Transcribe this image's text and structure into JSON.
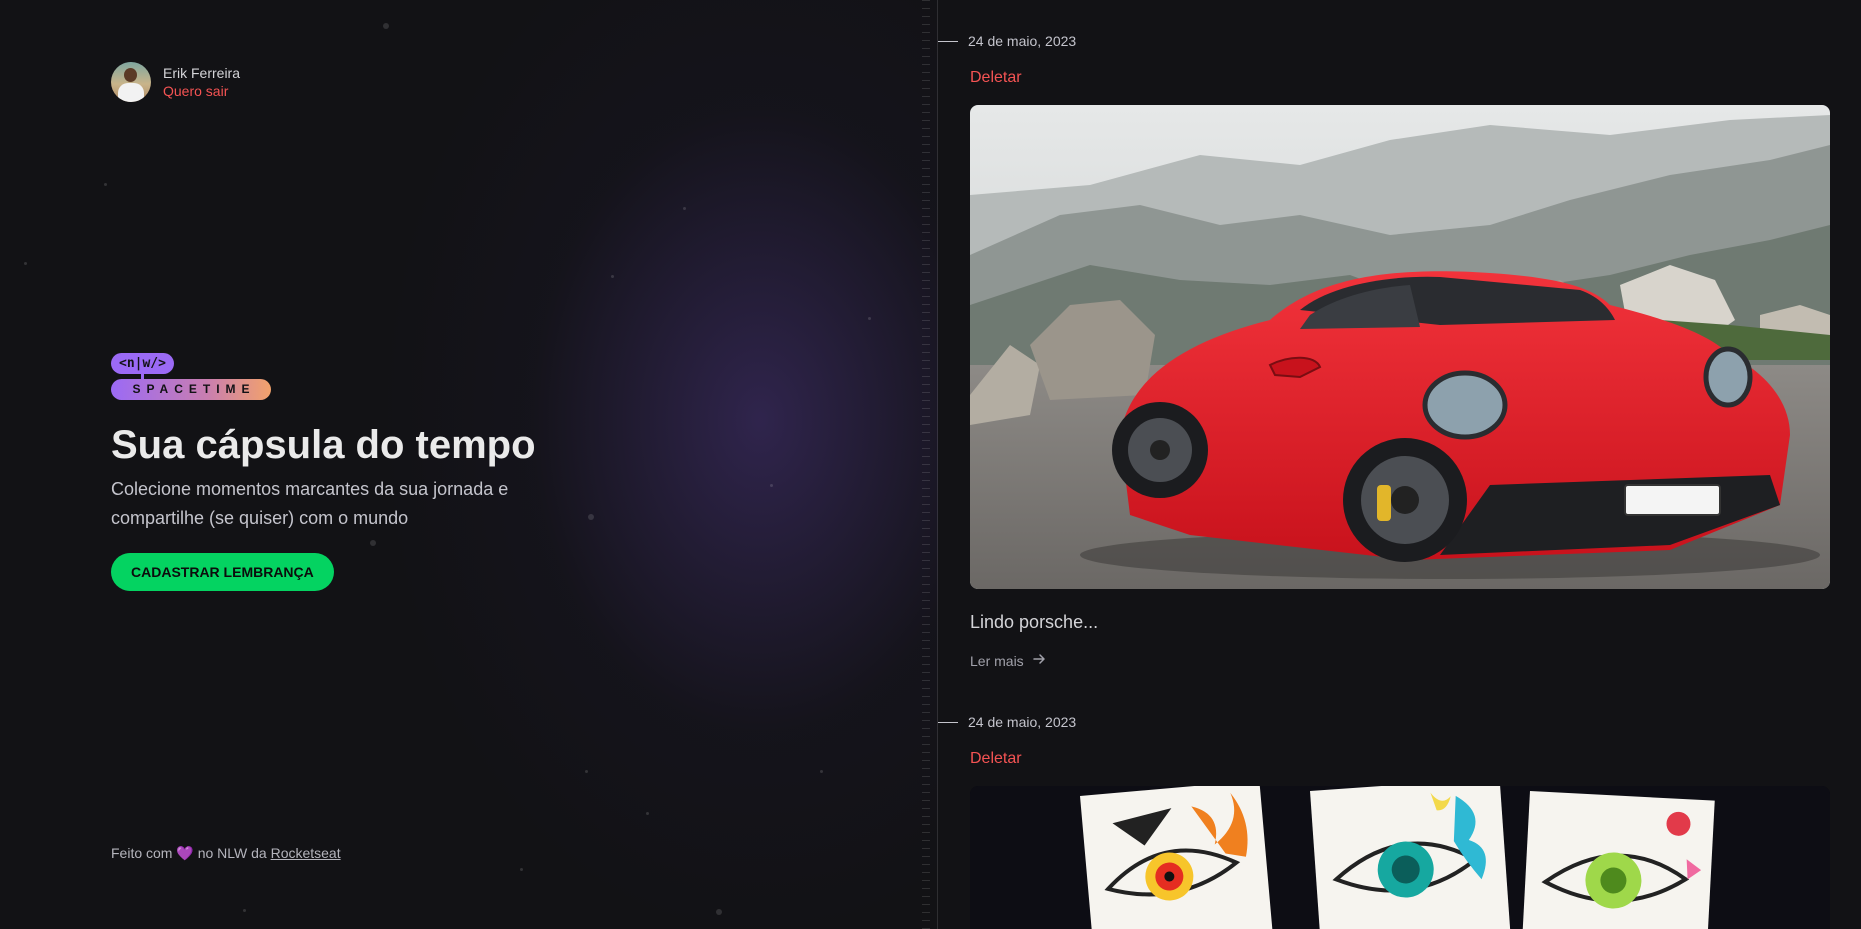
{
  "user": {
    "name": "Erik Ferreira",
    "logout_label": "Quero sair"
  },
  "logo": {
    "top_text": "<n|w/>",
    "bottom_text": "SPACETIME"
  },
  "hero": {
    "title": "Sua cápsula do tempo",
    "subtitle": "Colecione momentos marcantes da sua jornada e compartilhe (se quiser) com o mundo",
    "cta_label": "CADASTRAR LEMBRANÇA"
  },
  "footer": {
    "prefix": "Feito com",
    "heart": "💜",
    "middle": "no NLW da",
    "link_label": "Rocketseat"
  },
  "memories": [
    {
      "date": "24 de maio, 2023",
      "delete_label": "Deletar",
      "excerpt": "Lindo porsche...",
      "read_more_label": "Ler mais",
      "image_subject": "red-porsche-photo"
    },
    {
      "date": "24 de maio, 2023",
      "delete_label": "Deletar",
      "image_subject": "anime-eyes-drawings-photo"
    }
  ],
  "icons": {
    "read_more": "arrow-right-icon"
  },
  "colors": {
    "accent_green": "#04d361",
    "danger_red": "#f45353",
    "purple": "#8257e5",
    "background": "#121215"
  }
}
